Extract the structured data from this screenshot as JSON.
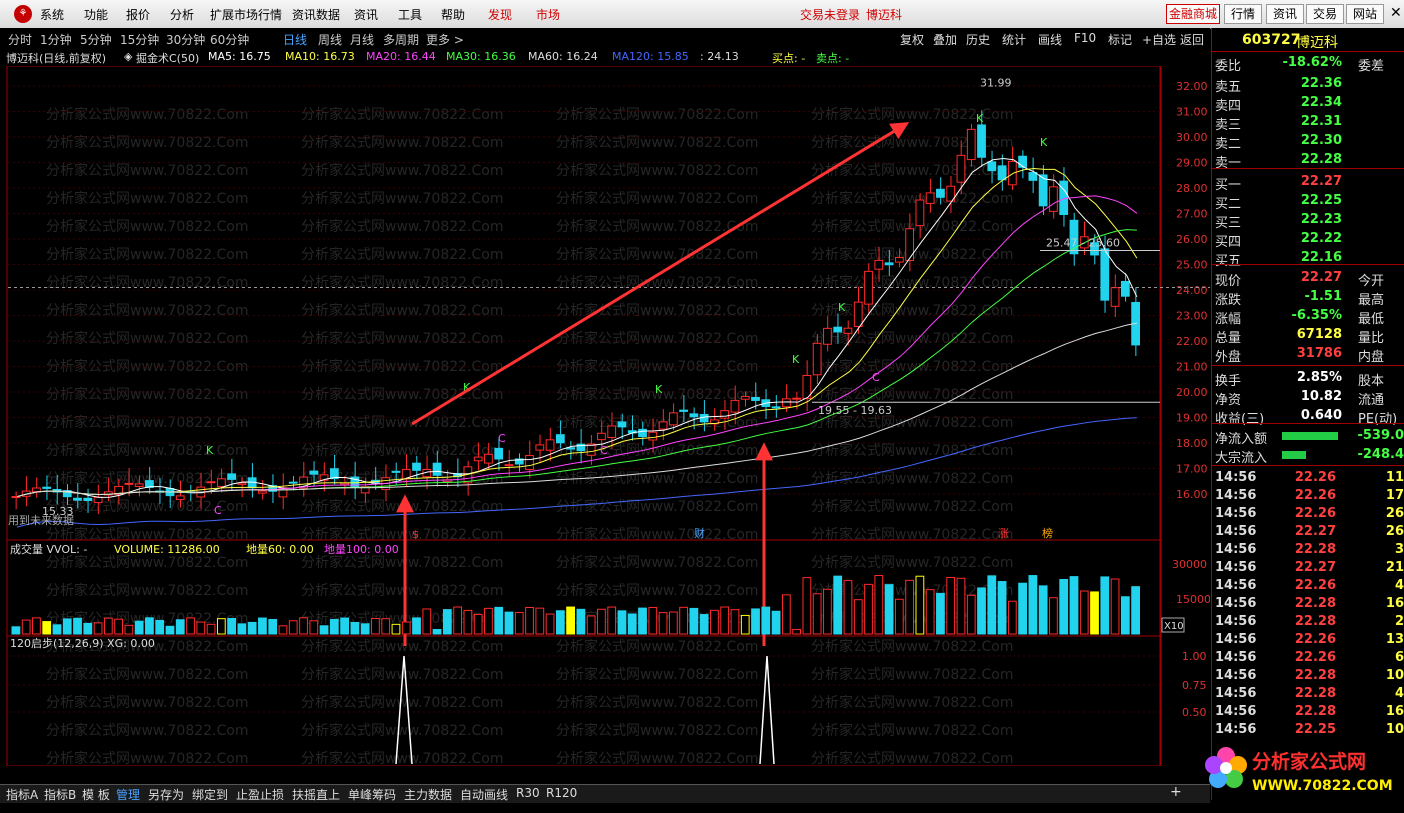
{
  "menu": {
    "items": [
      "系统",
      "功能",
      "报价",
      "分析",
      "扩展市场行情",
      "资讯数据",
      "资讯",
      "工具",
      "帮助"
    ],
    "discover": "发现",
    "market": "市场",
    "status": "交易未登录",
    "stock_short": "博迈科",
    "right_buttons": [
      "金融商城",
      "行情",
      "资讯",
      "交易",
      "网站"
    ]
  },
  "periods": [
    "分时",
    "1分钟",
    "5分钟",
    "15分钟",
    "30分钟",
    "60分钟",
    "日线",
    "周线",
    "月线",
    "多周期",
    "更多 >"
  ],
  "selected_period": "日线",
  "toolbar": [
    "复权",
    "叠加",
    "历史",
    "统计",
    "画线",
    "F10",
    "标记",
    "+自选",
    "返回"
  ],
  "info": {
    "title": "博迈科(日线,前复权)",
    "indicator": "掘金术C(50)",
    "ma": [
      {
        "label": "MA5: 16.75",
        "color": "#ffffff"
      },
      {
        "label": "MA10: 16.73",
        "color": "#ffff44"
      },
      {
        "label": "MA20: 16.44",
        "color": "#ff44ff"
      },
      {
        "label": "MA30: 16.36",
        "color": "#44ff44"
      },
      {
        "label": "MA60: 16.24",
        "color": "#dddddd"
      },
      {
        "label": "MA120: 15.85",
        "color": "#4466ff"
      }
    ],
    "extra": ": 24.13",
    "buy": "买点: -",
    "sell": "卖点: -"
  },
  "watermark": "分析家公式网www.70822.Com",
  "price_axis": [
    "32.00",
    "31.00",
    "30.00",
    "29.00",
    "28.00",
    "27.00",
    "26.00",
    "25.00",
    "24.00",
    "23.00",
    "22.00",
    "21.00",
    "20.00",
    "19.00",
    "18.00",
    "17.00",
    "16.00"
  ],
  "annotations": {
    "high": "31.99",
    "low": "15.33",
    "range_top": "25.47 - 25.60",
    "range_mid": "19.55 - 19.63",
    "future": "用到未来数据",
    "k": "K",
    "c": "C",
    "badge_s": "$",
    "badge_cai": "财",
    "badge_zhang": "涨",
    "badge_bang": "榜"
  },
  "volume": {
    "title": "成交量 VVOL: -",
    "volume_label": "VOLUME: 11286.00",
    "dl60": "地量60: 0.00",
    "dl100": "地量100: 0.00",
    "axis": [
      "30000",
      "15000"
    ],
    "unit": "X10"
  },
  "indicator2": {
    "title": "120启步(12,26,9) XG: 0.00",
    "axis": [
      "1.00",
      "0.75",
      "0.50"
    ]
  },
  "time_axis": [
    "2021年",
    "4",
    "5",
    "6",
    "7",
    "8",
    "9",
    "10"
  ],
  "panel": {
    "code": "603727",
    "name": "博迈科",
    "weibi_label": "委比",
    "weibi_val": "-18.62%",
    "weicha_label": "委差",
    "asks": [
      {
        "label": "卖五",
        "price": "22.36"
      },
      {
        "label": "卖四",
        "price": "22.34"
      },
      {
        "label": "卖三",
        "price": "22.31"
      },
      {
        "label": "卖二",
        "price": "22.30"
      },
      {
        "label": "卖一",
        "price": "22.28"
      }
    ],
    "bids": [
      {
        "label": "买一",
        "price": "22.27"
      },
      {
        "label": "买二",
        "price": "22.25"
      },
      {
        "label": "买三",
        "price": "22.23"
      },
      {
        "label": "买四",
        "price": "22.22"
      },
      {
        "label": "买五",
        "price": "22.16"
      }
    ],
    "stats": [
      {
        "label": "现价",
        "val": "22.27",
        "unit": "今开",
        "color": "#ff4040"
      },
      {
        "label": "涨跌",
        "val": "-1.51",
        "unit": "最高",
        "color": "#44ff44"
      },
      {
        "label": "涨幅",
        "val": "-6.35%",
        "unit": "最低",
        "color": "#44ff44"
      },
      {
        "label": "总量",
        "val": "67128",
        "unit": "量比",
        "color": "#ffff44"
      },
      {
        "label": "外盘",
        "val": "31786",
        "unit": "内盘",
        "color": "#ff4040"
      },
      {
        "label": "换手",
        "val": "2.85%",
        "unit": "股本",
        "color": "#ffffff"
      },
      {
        "label": "净资",
        "val": "10.82",
        "unit": "流通",
        "color": "#ffffff"
      },
      {
        "label": "收益(三)",
        "val": "0.640",
        "unit": "PE(动)",
        "color": "#ffffff"
      }
    ],
    "flow": [
      {
        "label": "净流入额",
        "val": "-539.0",
        "fill": 0.7
      },
      {
        "label": "大宗流入",
        "val": "-248.4",
        "fill": 0.3
      }
    ],
    "ticks": [
      {
        "t": "14:56",
        "p": "22.26",
        "q": "11"
      },
      {
        "t": "14:56",
        "p": "22.26",
        "q": "17"
      },
      {
        "t": "14:56",
        "p": "22.26",
        "q": "26"
      },
      {
        "t": "14:56",
        "p": "22.27",
        "q": "26"
      },
      {
        "t": "14:56",
        "p": "22.28",
        "q": "3"
      },
      {
        "t": "14:56",
        "p": "22.27",
        "q": "21"
      },
      {
        "t": "14:56",
        "p": "22.26",
        "q": "4"
      },
      {
        "t": "14:56",
        "p": "22.28",
        "q": "16"
      },
      {
        "t": "14:56",
        "p": "22.28",
        "q": "2"
      },
      {
        "t": "14:56",
        "p": "22.26",
        "q": "13"
      },
      {
        "t": "14:56",
        "p": "22.26",
        "q": "6"
      },
      {
        "t": "14:56",
        "p": "22.28",
        "q": "10"
      },
      {
        "t": "14:56",
        "p": "22.28",
        "q": "4"
      },
      {
        "t": "14:56",
        "p": "22.28",
        "q": "16"
      },
      {
        "t": "14:56",
        "p": "22.25",
        "q": "10"
      }
    ]
  },
  "bottom_tabs": [
    "指标A",
    "指标B",
    "模 板",
    "管理",
    "另存为",
    "绑定到",
    "止盈止损",
    "扶摇直上",
    "单峰筹码",
    "主力数据",
    "自动画线",
    "R30",
    "R120"
  ],
  "selected_tab": "管理",
  "brand": {
    "name": "分析家公式网",
    "url": "WWW.70822.COM"
  }
}
